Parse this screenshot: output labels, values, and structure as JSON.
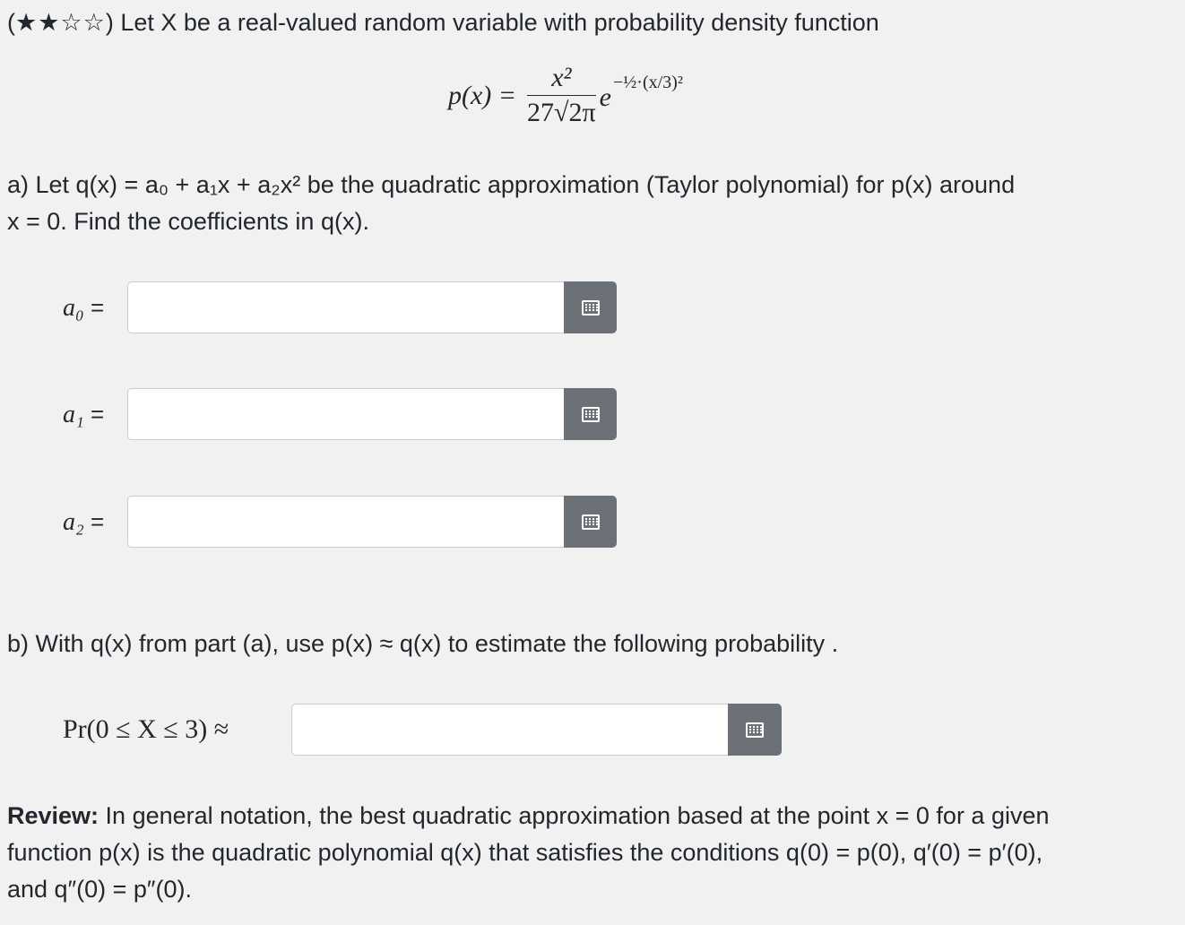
{
  "question": {
    "stars": "★★☆☆",
    "intro_text": "Let X be a real-valued random variable with probability density function"
  },
  "formula": {
    "lhs": "p(x) =",
    "numerator": "x²",
    "denominator": "27√2π",
    "exponential_base": "e",
    "exponent": "−½·(x/3)²"
  },
  "part_a": {
    "line1": "a) Let q(x) = a₀ + a₁x + a₂x² be the quadratic approximation (Taylor polynomial) for p(x) around",
    "line2": "x = 0. Find the coefficients in q(x).",
    "inputs": [
      {
        "label": "a₀",
        "value": "",
        "placeholder": ""
      },
      {
        "label": "a₁",
        "value": "",
        "placeholder": ""
      },
      {
        "label": "a₂",
        "value": "",
        "placeholder": ""
      }
    ]
  },
  "part_b": {
    "line": "b) With q(x) from part (a), use p(x) ≈ q(x) to estimate the following probability .",
    "input": {
      "label": "Pr(0 ≤ X ≤ 3) ≈",
      "value": "",
      "placeholder": ""
    }
  },
  "review": {
    "heading": "Review:",
    "line1": " In general notation, the best quadratic approximation based at the point x = 0 for a given",
    "line2": "function p(x) is the quadratic polynomial q(x) that satisfies the conditions q(0) = p(0), q′(0) = p′(0),",
    "line3": "and q″(0) = p″(0)."
  },
  "colors": {
    "background": "#f1f1f2",
    "text": "#22272d",
    "input_border": "#c9ccd1",
    "keyboard_button": "#6c7178"
  },
  "icons": {
    "keyboard": "keyboard-icon"
  }
}
